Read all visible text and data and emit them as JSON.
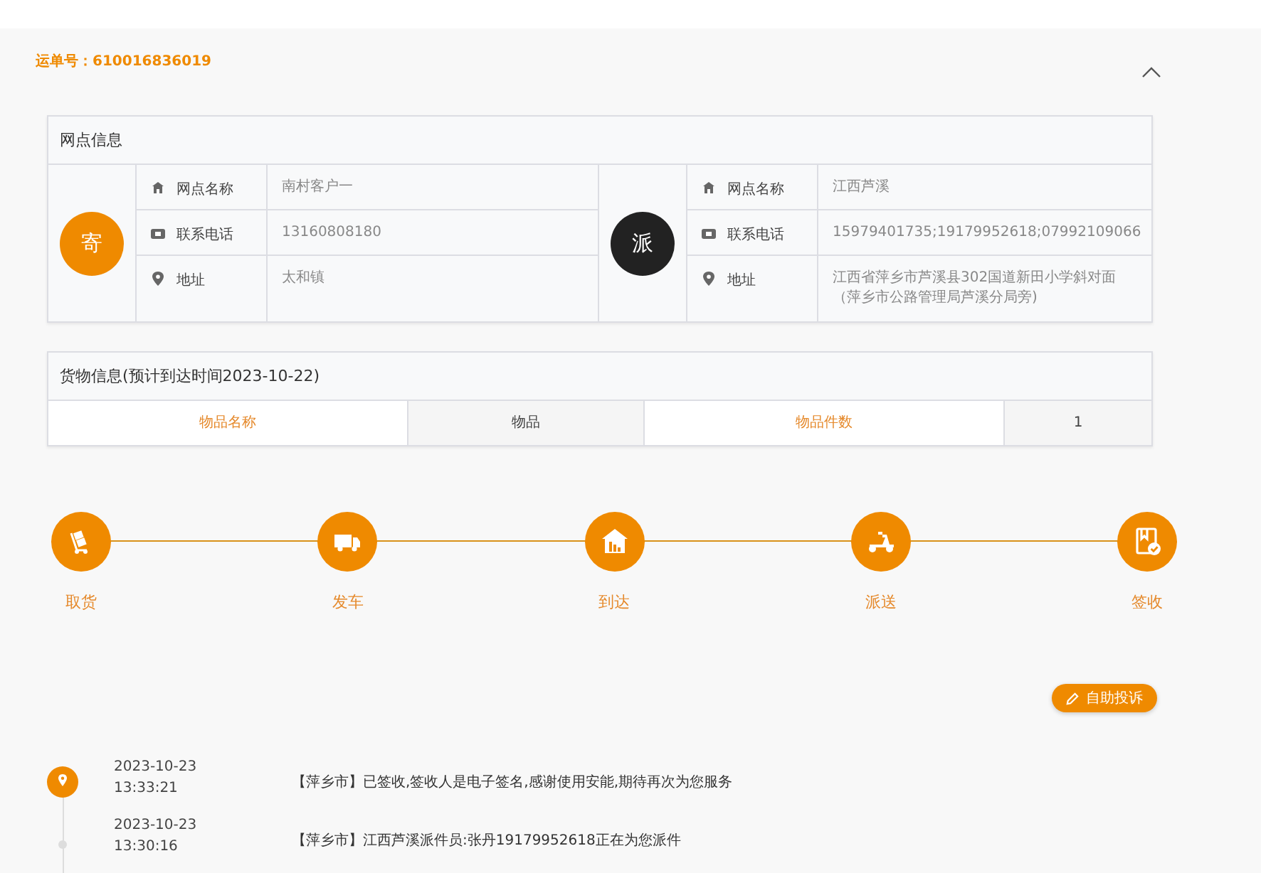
{
  "waybill": {
    "label": "运单号：",
    "number": "610016836019",
    "expanded": true
  },
  "network": {
    "title": "网点信息",
    "parties": [
      {
        "kind": "sender",
        "badge": "寄",
        "fields": [
          {
            "kind": "name",
            "label": "网点名称",
            "value": "南村客户一"
          },
          {
            "kind": "phone",
            "label": "联系电话",
            "value": "13160808180"
          },
          {
            "kind": "address",
            "label": "地址",
            "value": "太和镇"
          }
        ]
      },
      {
        "kind": "dispatcher",
        "badge": "派",
        "fields": [
          {
            "kind": "name",
            "label": "网点名称",
            "value": "江西芦溪"
          },
          {
            "kind": "phone",
            "label": "联系电话",
            "value": "15979401735;19179952618;07992109066"
          },
          {
            "kind": "address",
            "label": "地址",
            "value": "江西省萍乡市芦溪县302国道新田小学斜对面（萍乡市公路管理局芦溪分局旁)"
          }
        ]
      }
    ]
  },
  "goods": {
    "title": "货物信息(预计到达时间2023-10-22)",
    "cells": [
      {
        "kind": "label",
        "text": "物品名称"
      },
      {
        "kind": "value",
        "text": "物品"
      },
      {
        "kind": "label",
        "text": "物品件数"
      },
      {
        "kind": "value",
        "text": "1"
      }
    ]
  },
  "steps": [
    {
      "kind": "pickup",
      "label": "取货"
    },
    {
      "kind": "depart",
      "label": "发车"
    },
    {
      "kind": "arrive",
      "label": "到达"
    },
    {
      "kind": "deliver",
      "label": "派送"
    },
    {
      "kind": "sign",
      "label": "签收"
    }
  ],
  "complaint_button": "自助投诉",
  "tracking": [
    {
      "latest": true,
      "date": "2023-10-23",
      "time": "13:33:21",
      "message": "【萍乡市】已签收,签收人是电子签名,感谢使用安能,期待再次为您服务"
    },
    {
      "latest": false,
      "date": "2023-10-23",
      "time": "13:30:16",
      "message": "【萍乡市】江西芦溪派件员:张丹19179952618正在为您派件"
    }
  ]
}
